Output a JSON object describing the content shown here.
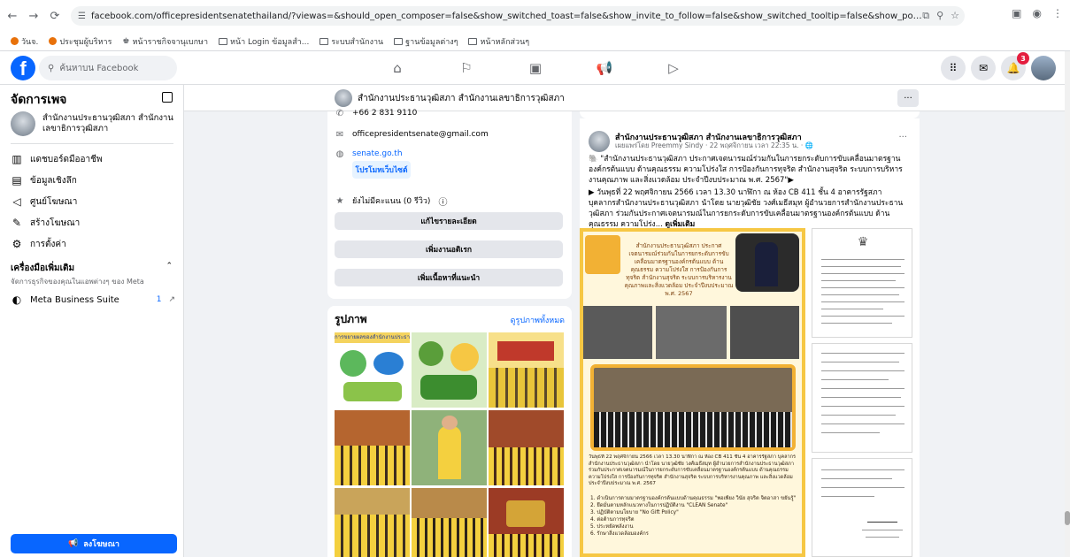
{
  "browser": {
    "url": "facebook.com/officepresidentsenatethailand/?viewas=&should_open_composer=false&show_switched_toast=false&show_invite_to_follow=false&show_switched_tooltip=false&show_podcast_settings=false&show_community_review_changes=false...",
    "bookmarks": [
      "วันจ.",
      "ประชุมผู้บริหาร",
      "หน้าราชกิจจานุเบกษา",
      "หน้า Login ข้อมูลสำ...",
      "ระบบสำนักงาน",
      "ฐานข้อมูลต่างๆ",
      "หน้าหลักส่วนๆ"
    ]
  },
  "fb_nav": {
    "search_placeholder": "ค้นหาบน Facebook",
    "notification_count": "3"
  },
  "sidebar": {
    "title": "จัดการเพจ",
    "page_name": "สำนักงานประธานวุฒิสภา สำนักงานเลขาธิการวุฒิสภา",
    "items": [
      {
        "icon": "dashboard-icon",
        "label": "แดชบอร์ดมืออาชีพ"
      },
      {
        "icon": "insights-icon",
        "label": "ข้อมูลเชิงลึก"
      },
      {
        "icon": "ad-center-icon",
        "label": "ศูนย์โฆษณา"
      },
      {
        "icon": "create-ad-icon",
        "label": "สร้างโฆษณา"
      },
      {
        "icon": "settings-icon",
        "label": "การตั้งค่า"
      }
    ],
    "tools_heading": "เครื่องมือเพิ่มเติม",
    "tools_sub": "จัดการธุรกิจของคุณในแอพต่างๆ ของ Meta",
    "mbs_label": "Meta Business Suite",
    "mbs_count": "1",
    "ad_button": "ลงโฆษณา"
  },
  "page_header": {
    "title": "สำนักงานประธานวุฒิสภา สำนักงานเลขาธิการวุฒิสภา",
    "more": "···"
  },
  "intro": {
    "phone": "+66 2 831 9110",
    "email": "officepresidentsenate@gmail.com",
    "website": "senate.go.th",
    "promo_btn": "โปรโมทเว็บไซต์",
    "rating": "ยังไม่มีคะแนน (0 รีวิว)",
    "btn_edit": "แก้ไขรายละเอียด",
    "btn_add_feature": "เพิ่มงานอดิเรก",
    "btn_add_featured": "เพิ่มเนื้อหาที่แนะนำ"
  },
  "photos": {
    "heading": "รูปภาพ",
    "see_all": "ดูรูปภาพทั้งหมด",
    "thumb_caption": "การขยายผลของสำนักงานประธาน"
  },
  "post": {
    "author": "สำนักงานประธานวุฒิสภา สำนักงานเลขาธิการวุฒิสภา",
    "meta": "เผยแพร่โดย Preemmy Sindy · 22 พฤศจิกายน เวลา 22:35 น. · 🌐",
    "para1": "🐘 \"สำนักงานประธานวุฒิสภา ประกาศเจตนารมณ์ร่วมกันในการยกระดับการขับเคลื่อนมาตรฐานองค์กรต้นแบบ ด้านคุณธรรม ความโปร่งใส การป้องกันการทุจริต สำนักงานสุจริต ระบบการบริหารงานคุณภาพ และสิ่งแวดล้อม ประจำปีงบประมาณ พ.ศ. 2567\"▶",
    "para2": "▶ วันพุธที่ 22 พฤศจิกายน 2566 เวลา 13.30 นาฬิกา ณ ห้อง CB 411 ชั้น 4 อาคารรัฐสภา บุคลากรสำนักงานประธานวุฒิสภา นำโดย นายวุฒิชัย วงศ์เมธีสมุท ผู้อำนวยการสำนักงานประธานวุฒิสภา ร่วมกันประกาศเจตนารมณ์ในการยกระดับการขับเคลื่อนมาตรฐานองค์กรต้นแบบ ด้านคุณธรรม ความโปร่ง...",
    "see_more": "ดูเพิ่มเติม",
    "poster_title": "สำนักงานประธานวุฒิสภา ประกาศเจตนารมณ์ร่วมกันในการยกระดับการขับเคลื่อนมาตรฐานองค์กรต้นแบบ ด้านคุณธรรม ความโปร่งใส การป้องกันการทุจริต สำนักงานสุจริต ระบบการบริหารงานคุณภาพและสิ่งแวดล้อม ประจำปีงบประมาณ พ.ศ. 2567",
    "poster_body": "วันพุธที่ 22 พฤศจิกายน 2566 เวลา 13.30 นาฬิกา ณ ห้อง CB 411 ชั้น 4 อาคารรัฐสภา บุคลากรสำนักงานประธานวุฒิสภา นำโดย นายวุฒิชัย วงศ์เมธีสมุท ผู้อำนวยการสำนักงานประธานวุฒิสภา ร่วมกันประกาศเจตนารมณ์ในการยกระดับการขับเคลื่อนมาตรฐานองค์กรต้นแบบ ด้านคุณธรรม ความโปร่งใส การป้องกันการทุจริต สำนักงานสุจริต ระบบการบริหารงานคุณภาพ และสิ่งแวดล้อม ประจำปีงบประมาณ พ.ศ. 2567",
    "poster_list": [
      "1. ดำเนินการตามมาตรฐานองค์กรต้นแบบด้านคุณธรรม \"พอเพียง วินัย สุจริต จิตอาสา ขยันรู้\"",
      "2. ยึดมั่นตามหลักแนวทางในการปฏิบัติงาน \"CLEAN Senate\"",
      "3. ปฏิบัติตามนโยบาย \"No Gift Policy\"",
      "4. ต่อต้านการทุจริต",
      "5. ประหยัดพลังงาน",
      "6. รักษาสิ่งแวดล้อมองค์กร"
    ]
  }
}
